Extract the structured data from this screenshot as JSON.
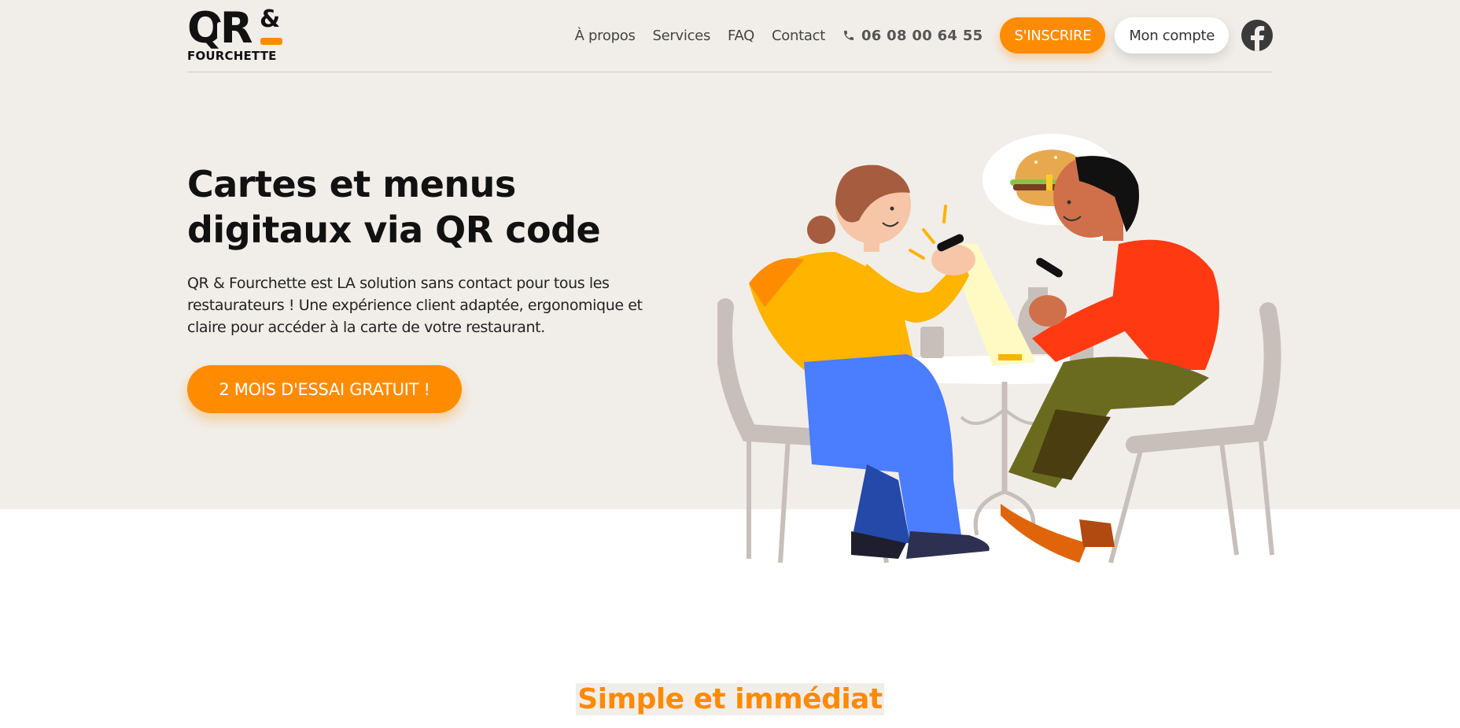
{
  "brand": {
    "logo_main": "QR",
    "logo_amp": "&",
    "logo_sub": "FOURCHETTE"
  },
  "nav": {
    "links": [
      "À propos",
      "Services",
      "FAQ",
      "Contact"
    ],
    "phone": "06 08 00 64 55",
    "signup_label": "S'INSCRIRE",
    "account_label": "Mon compte",
    "social_icon": "facebook-icon"
  },
  "hero": {
    "title_line1": "Cartes et menus",
    "title_line2": "digitaux via QR code",
    "description": "QR & Fourchette est LA solution sans contact pour tous les restaurateurs ! Une expérience client adaptée, ergonomique et claire pour accéder à la carte de votre restaurant.",
    "cta_label": "2 MOIS D'ESSAI GRATUIT !"
  },
  "section": {
    "title": "Simple et immédiat"
  },
  "colors": {
    "accent": "#ff8c00",
    "hero_bg": "#f1eeea",
    "text": "#111111"
  }
}
